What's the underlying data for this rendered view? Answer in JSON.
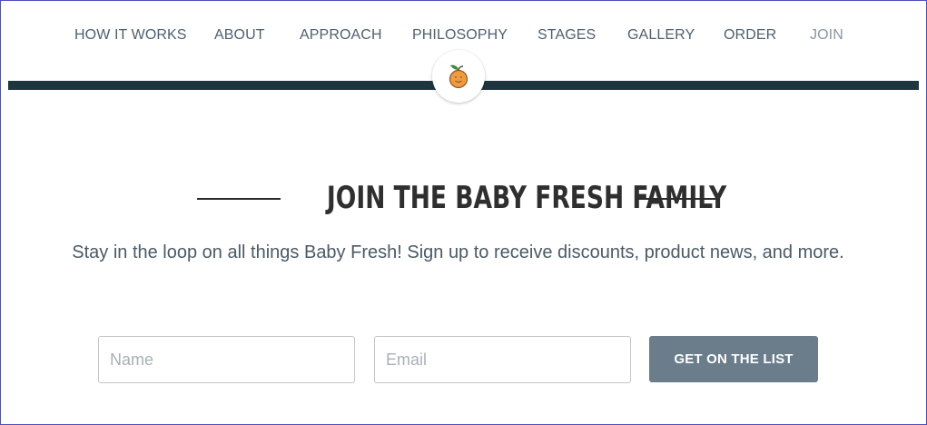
{
  "nav": {
    "items": [
      {
        "label": "HOW IT WORKS"
      },
      {
        "label": "ABOUT"
      },
      {
        "label": "APPROACH"
      },
      {
        "label": "PHILOSOPHY"
      },
      {
        "label": "STAGES"
      },
      {
        "label": "GALLERY"
      },
      {
        "label": "ORDER"
      },
      {
        "label": "JOIN",
        "active": true
      }
    ]
  },
  "logo": {
    "icon": "orange-fruit-icon"
  },
  "signup": {
    "heading": "JOIN THE BABY FRESH FAMILY",
    "subtitle": "Stay in the loop on all things Baby Fresh! Sign up to receive discounts, product news, and more.",
    "name_placeholder": "Name",
    "name_value": "",
    "email_placeholder": "Email",
    "email_value": "",
    "submit_label": "GET ON THE LIST"
  },
  "colors": {
    "nav_text": "#4e6070",
    "nav_active": "#8797a6",
    "bar": "#1e3540",
    "button": "#6b7d8b",
    "heading": "#2f2f2f"
  }
}
